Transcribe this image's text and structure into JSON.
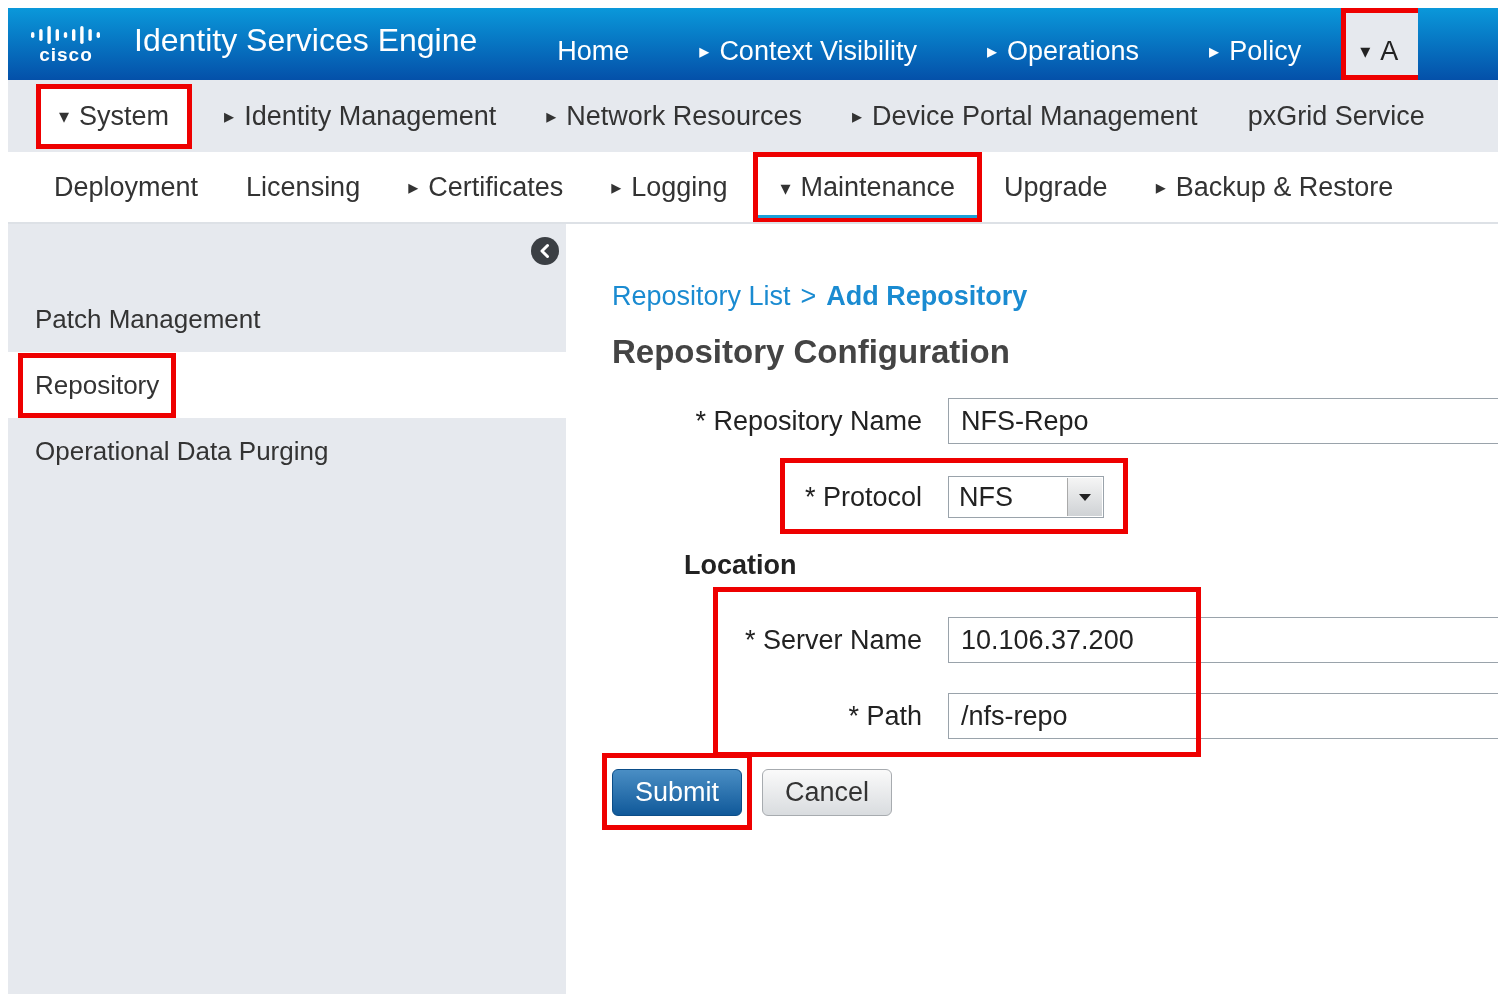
{
  "app": {
    "logo_text": "cisco",
    "title": "Identity Services Engine"
  },
  "top_nav": [
    {
      "label": "Home",
      "selected": false,
      "highlighted": false
    },
    {
      "label": "Context Visibility",
      "caret": "▸",
      "selected": false,
      "highlighted": false
    },
    {
      "label": "Operations",
      "caret": "▸",
      "selected": false,
      "highlighted": false
    },
    {
      "label": "Policy",
      "caret": "▸",
      "selected": false,
      "highlighted": false
    },
    {
      "label": "A",
      "caret": "▾",
      "selected": true,
      "highlighted": true
    }
  ],
  "sub_nav": [
    {
      "label": "System",
      "caret": "▾",
      "selected": true,
      "highlighted": true
    },
    {
      "label": "Identity Management",
      "caret": "▸",
      "selected": false,
      "highlighted": false
    },
    {
      "label": "Network Resources",
      "caret": "▸",
      "selected": false,
      "highlighted": false
    },
    {
      "label": "Device Portal Management",
      "caret": "▸",
      "selected": false,
      "highlighted": false
    },
    {
      "label": "pxGrid Service",
      "selected": false,
      "highlighted": false
    }
  ],
  "section_tabs": [
    {
      "label": "Deployment",
      "selected": false,
      "highlighted": false
    },
    {
      "label": "Licensing",
      "selected": false,
      "highlighted": false
    },
    {
      "label": "Certificates",
      "caret": "▸",
      "selected": false,
      "highlighted": false
    },
    {
      "label": "Logging",
      "caret": "▸",
      "selected": false,
      "highlighted": false
    },
    {
      "label": "Maintenance",
      "caret": "▾",
      "selected": true,
      "highlighted": true
    },
    {
      "label": "Upgrade",
      "selected": false,
      "highlighted": false
    },
    {
      "label": "Backup & Restore",
      "caret": "▸",
      "selected": false,
      "highlighted": false
    }
  ],
  "sidebar": {
    "items": [
      {
        "label": "Patch Management",
        "selected": false,
        "highlighted": false
      },
      {
        "label": "Repository",
        "selected": true,
        "highlighted": true
      },
      {
        "label": "Operational Data Purging",
        "selected": false,
        "highlighted": false
      }
    ]
  },
  "breadcrumb": [
    {
      "label": "Repository List",
      "kind": "link"
    },
    {
      "label": ">",
      "kind": "separator"
    },
    {
      "label": "Add Repository",
      "kind": "current"
    }
  ],
  "heading": "Repository Configuration",
  "form": {
    "fields": [
      {
        "label": "* Repository Name",
        "value": "NFS-Repo",
        "kind": "text",
        "highlighted": false
      },
      {
        "label": "* Protocol",
        "value": "NFS",
        "kind": "select",
        "highlighted": true
      }
    ],
    "location": {
      "title": "Location",
      "highlighted": true,
      "fields": [
        {
          "label": "* Server Name",
          "value": "10.106.37.200",
          "kind": "text",
          "highlighted": false
        },
        {
          "label": "* Path",
          "value": "/nfs-repo",
          "kind": "text",
          "highlighted": false
        }
      ]
    }
  },
  "buttons": [
    {
      "label": "Submit",
      "kind": "primary",
      "highlighted": true
    },
    {
      "label": "Cancel",
      "kind": "secondary",
      "highlighted": false
    }
  ]
}
